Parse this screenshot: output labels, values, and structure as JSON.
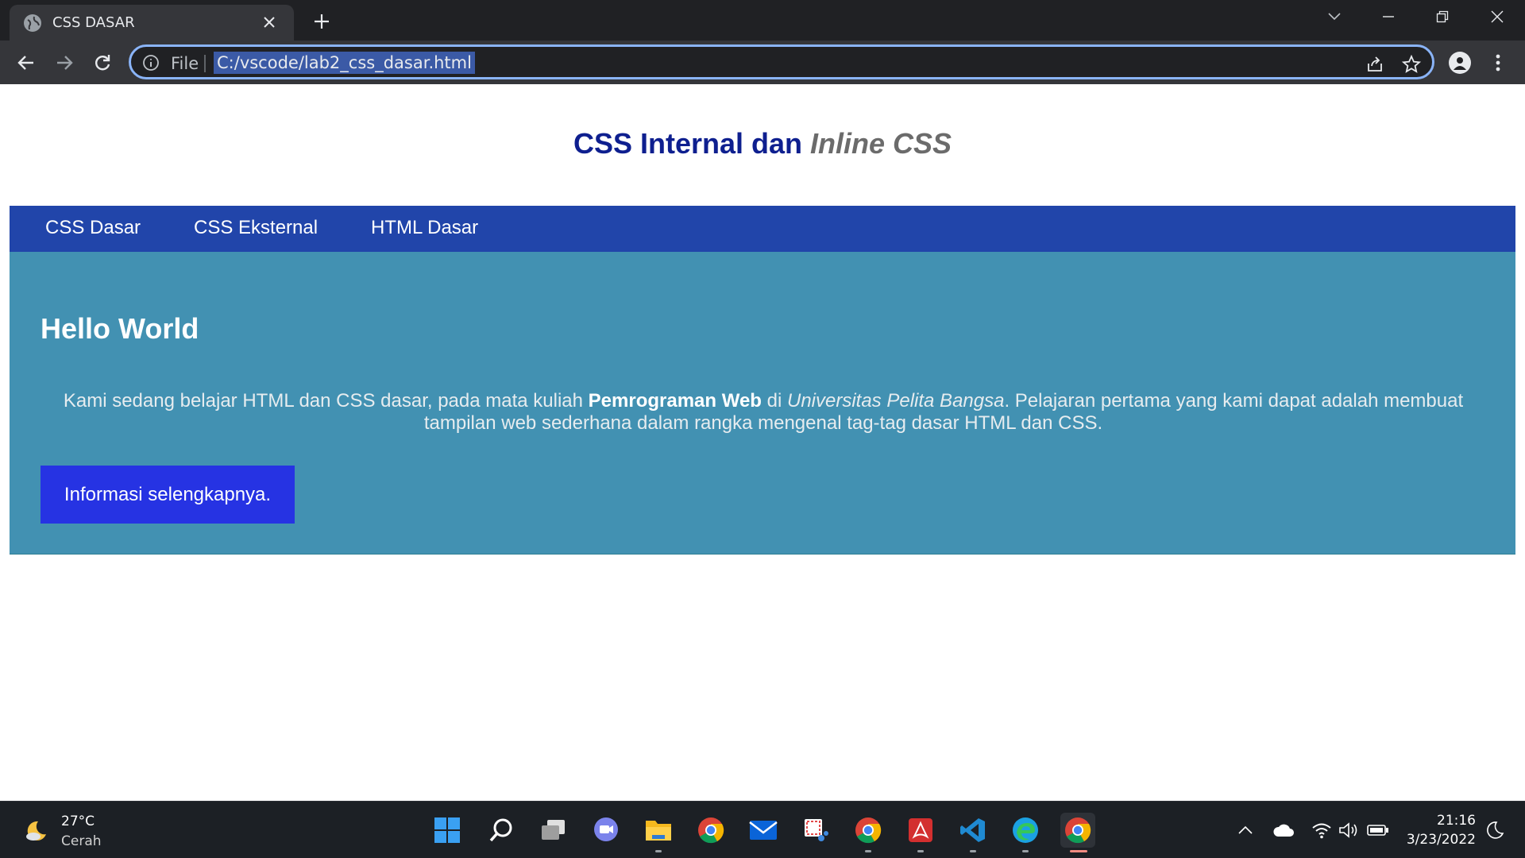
{
  "browser": {
    "tab_title": "CSS DASAR",
    "omnibox_scheme": "File",
    "url": "C:/vscode/lab2_css_dasar.html"
  },
  "page": {
    "title_main": "CSS Internal dan ",
    "title_italic": "Inline CSS",
    "nav": [
      "CSS Dasar",
      "CSS Eksternal",
      "HTML Dasar"
    ],
    "heading": "Hello World",
    "para_1": "Kami sedang belajar HTML dan CSS dasar, pada mata kuliah ",
    "para_bold": "Pemrograman Web",
    "para_2": " di ",
    "para_italic": "Universitas Pelita Bangsa",
    "para_3": ". Pelajaran pertama yang kami dapat adalah membuat tampilan web sederhana dalam rangka mengenal tag-tag dasar HTML dan CSS.",
    "button_label": "Informasi selengkapnya."
  },
  "taskbar": {
    "weather_temp": "27°C",
    "weather_condition": "Cerah",
    "clock_time": "21:16",
    "clock_date": "3/23/2022",
    "apps": [
      "start-icon",
      "search-icon",
      "task-view-icon",
      "teams-chat-icon",
      "file-explorer-icon",
      "chrome-icon",
      "mail-icon",
      "snipping-tool-icon",
      "chrome-icon",
      "acrobat-icon",
      "vscode-icon",
      "edge-icon",
      "chrome-icon"
    ]
  },
  "colors": {
    "title_blue": "#0e1f8f",
    "navbar_blue": "#2145aa",
    "content_teal": "#4291b2",
    "button_blue": "#2633e3",
    "omnibox_focus": "#8ab4f8"
  }
}
